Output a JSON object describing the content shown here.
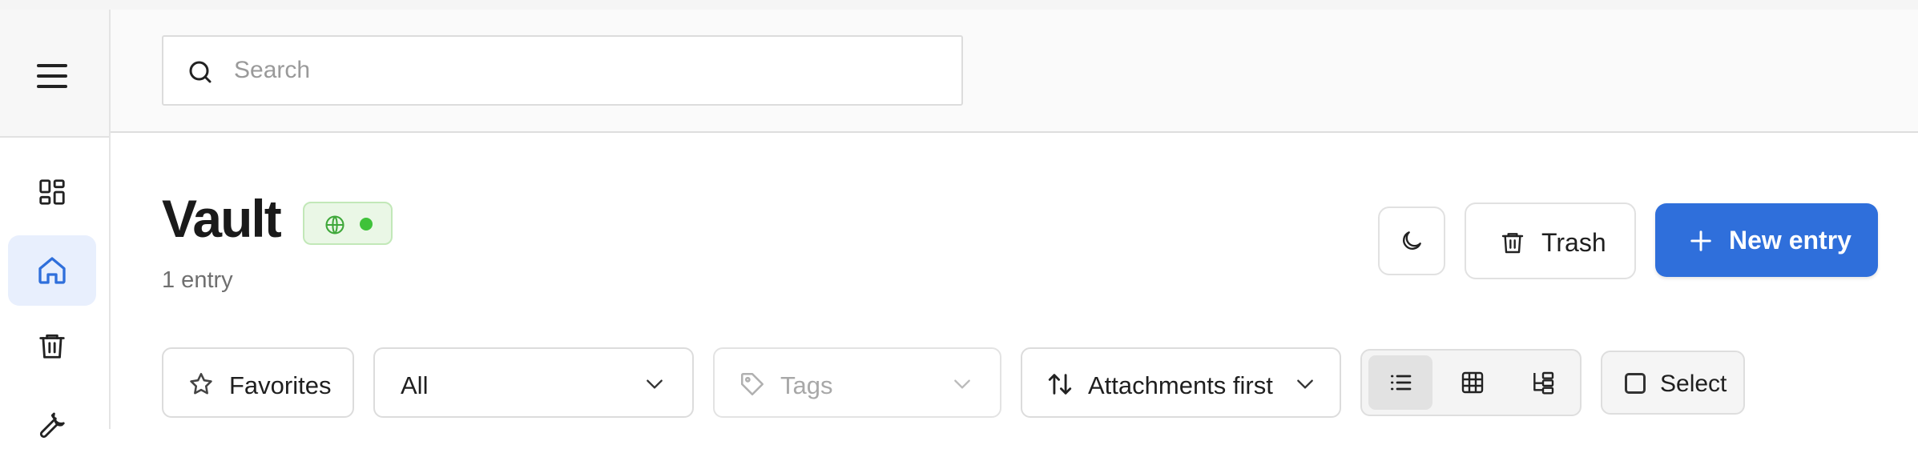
{
  "search": {
    "placeholder": "Search",
    "value": ""
  },
  "page": {
    "title": "Vault",
    "count_label": "1 entry"
  },
  "status": {
    "color": "#3fc23a"
  },
  "toolbar": {
    "trash_label": "Trash",
    "new_entry_label": "New entry"
  },
  "sidebar": {
    "items": [
      {
        "icon": "dashboard-icon",
        "active": false
      },
      {
        "icon": "home-icon",
        "active": true
      },
      {
        "icon": "trash-icon",
        "active": false
      },
      {
        "icon": "wrench-icon",
        "active": false
      }
    ]
  },
  "filters": {
    "favorites_label": "Favorites",
    "scope_selected": "All",
    "tags_placeholder": "Tags",
    "sort_selected": "Attachments first",
    "select_label": "Select"
  },
  "view_modes": [
    {
      "icon": "list-icon",
      "active": true
    },
    {
      "icon": "grid-icon",
      "active": false
    },
    {
      "icon": "tree-icon",
      "active": false
    }
  ],
  "colors": {
    "accent": "#2f6fdb",
    "active_nav": "#e8effd",
    "badge_bg": "#eaf7e6"
  }
}
